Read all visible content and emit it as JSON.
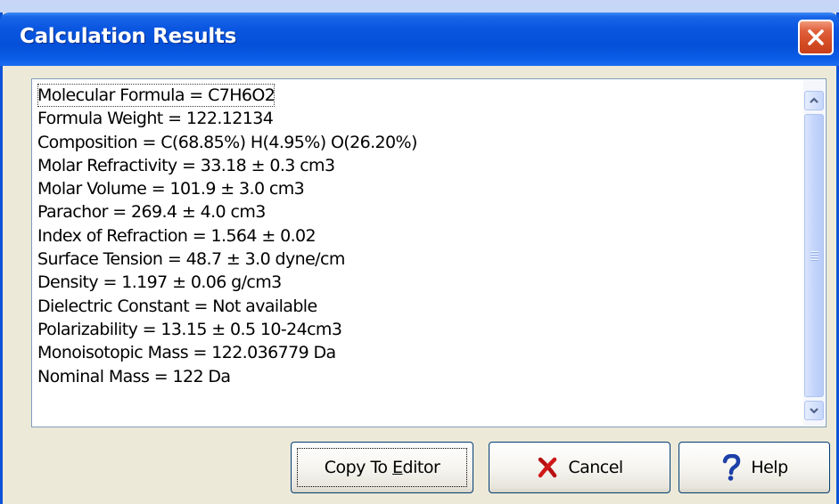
{
  "window": {
    "title": "Calculation Results",
    "title_color": "#ffffff",
    "accent": "#0a56e0"
  },
  "results": {
    "lines": [
      "Molecular Formula = C7H6O2",
      "Formula Weight = 122.12134",
      "Composition =  C(68.85%) H(4.95%) O(26.20%)",
      "Molar Refractivity = 33.18 ± 0.3 cm3",
      "Molar Volume = 101.9 ± 3.0 cm3",
      "Parachor = 269.4 ± 4.0 cm3",
      "Index of Refraction = 1.564 ± 0.02",
      "Surface Tension = 48.7 ± 3.0 dyne/cm",
      "Density = 1.197 ± 0.06 g/cm3",
      "Dielectric Constant = Not available",
      "Polarizability = 13.15 ± 0.5 10-24cm3",
      "Monoisotopic Mass = 122.036779 Da",
      "Nominal Mass = 122 Da"
    ]
  },
  "buttons": {
    "copy_prefix": "Copy To ",
    "copy_mnemonic": "E",
    "copy_suffix": "ditor",
    "cancel_label": "Cancel",
    "help_label": "Help"
  },
  "icons": {
    "close": "close-x-icon",
    "cancel": "red-x-icon",
    "help": "question-mark-icon",
    "scroll_up": "chevron-up-icon",
    "scroll_down": "chevron-down-icon"
  }
}
